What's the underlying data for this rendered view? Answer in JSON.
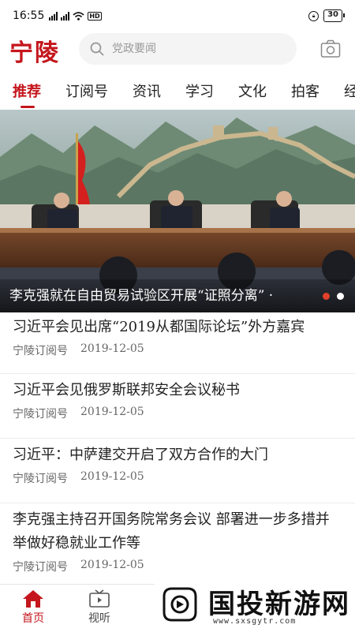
{
  "status_bar": {
    "time": "16:55",
    "network": "HD",
    "battery": "30"
  },
  "header": {
    "logo": "宁陵",
    "search_placeholder": "党政要闻"
  },
  "tabs": [
    {
      "label": "推荐",
      "active": true
    },
    {
      "label": "订阅号",
      "active": false
    },
    {
      "label": "资讯",
      "active": false
    },
    {
      "label": "学习",
      "active": false
    },
    {
      "label": "文化",
      "active": false
    },
    {
      "label": "拍客",
      "active": false
    },
    {
      "label": "经济",
      "active": false
    }
  ],
  "banner": {
    "caption": "李克强就在自由贸易试验区开展“证照分离”",
    "ellipsis": "·",
    "slide_count": 2,
    "active_slide": 1
  },
  "news": [
    {
      "title": "习近平会见出席“2019从都国际论坛”外方嘉宾",
      "source": "宁陵订阅号",
      "date": "2019-12-05"
    },
    {
      "title": "习近平会见俄罗斯联邦安全会议秘书",
      "source": "宁陵订阅号",
      "date": "2019-12-05"
    },
    {
      "title": "习近平：中萨建交开启了双方合作的大门",
      "source": "宁陵订阅号",
      "date": "2019-12-05"
    },
    {
      "title": "李克强主持召开国务院常务会议 部署进一步多措并举做好稳就业工作等",
      "source": "宁陵订阅号",
      "date": "2019-12-05"
    }
  ],
  "bottom_nav": [
    {
      "label": "首页",
      "icon": "home-icon",
      "active": true
    },
    {
      "label": "视听",
      "icon": "tv-icon",
      "active": false
    }
  ],
  "watermark": {
    "text": "国投新游网",
    "url": "www.sxsgytr.com"
  },
  "colors": {
    "accent": "#c4161c",
    "dot_active": "#e0412c"
  }
}
